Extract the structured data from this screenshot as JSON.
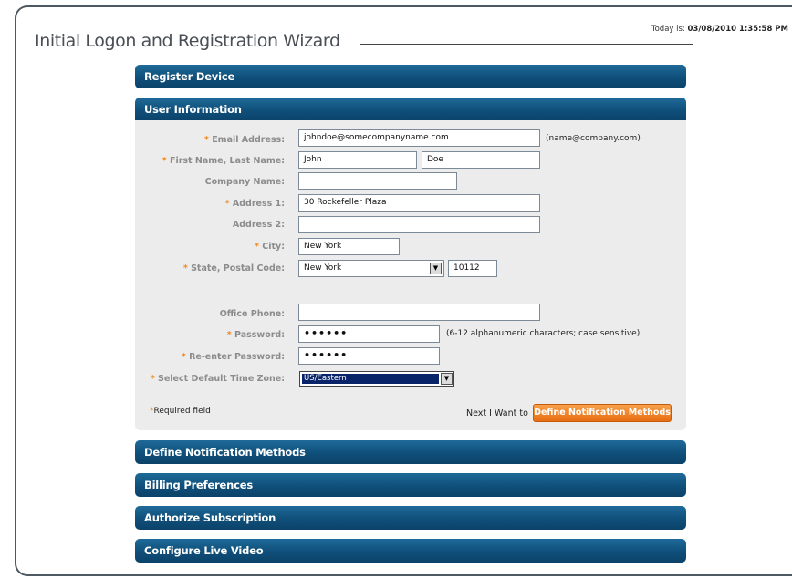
{
  "header": {
    "title": "Initial Logon and Registration Wizard",
    "date_label": "Today is:",
    "date_value": "03/08/2010 1:35:58 PM"
  },
  "sections": {
    "register_device": "Register Device",
    "user_information": "User Information",
    "define_notification_methods": "Define Notification Methods",
    "billing_preferences": "Billing Preferences",
    "authorize_subscription": "Authorize Subscription",
    "configure_live_video": "Configure Live Video"
  },
  "form": {
    "email_label": "Email Address:",
    "email_value": "johndoe@somecompanyname.com",
    "email_hint": "(name@company.com)",
    "name_label": "First Name, Last Name:",
    "first_name_value": "John",
    "last_name_value": "Doe",
    "company_label": "Company Name:",
    "company_value": "",
    "address1_label": "Address 1:",
    "address1_value": "30 Rockefeller Plaza",
    "address2_label": "Address 2:",
    "address2_value": "",
    "city_label": "City:",
    "city_value": "New York",
    "state_postal_label": "State, Postal Code:",
    "state_value": "New York",
    "postal_value": "10112",
    "office_phone_label": "Office Phone:",
    "office_phone_value": "",
    "password_label": "Password:",
    "password_value": "••••••",
    "password_hint": "(6-12 alphanumeric characters; case sensitive)",
    "reenter_label": "Re-enter Password:",
    "reenter_value": "••••••",
    "timezone_label": "Select Default Time Zone:",
    "timezone_value": "US/Eastern",
    "required_asterisk": "*",
    "required_text": "Required field",
    "next_text": "Next I Want to",
    "next_button": "Define Notification Methods"
  },
  "icons": {
    "dropdown_arrow": "chevron-down-icon"
  },
  "colors": {
    "bar_blue": "#0f4f7a",
    "accent_orange": "#f08a24",
    "panel_gray": "#ececec"
  }
}
